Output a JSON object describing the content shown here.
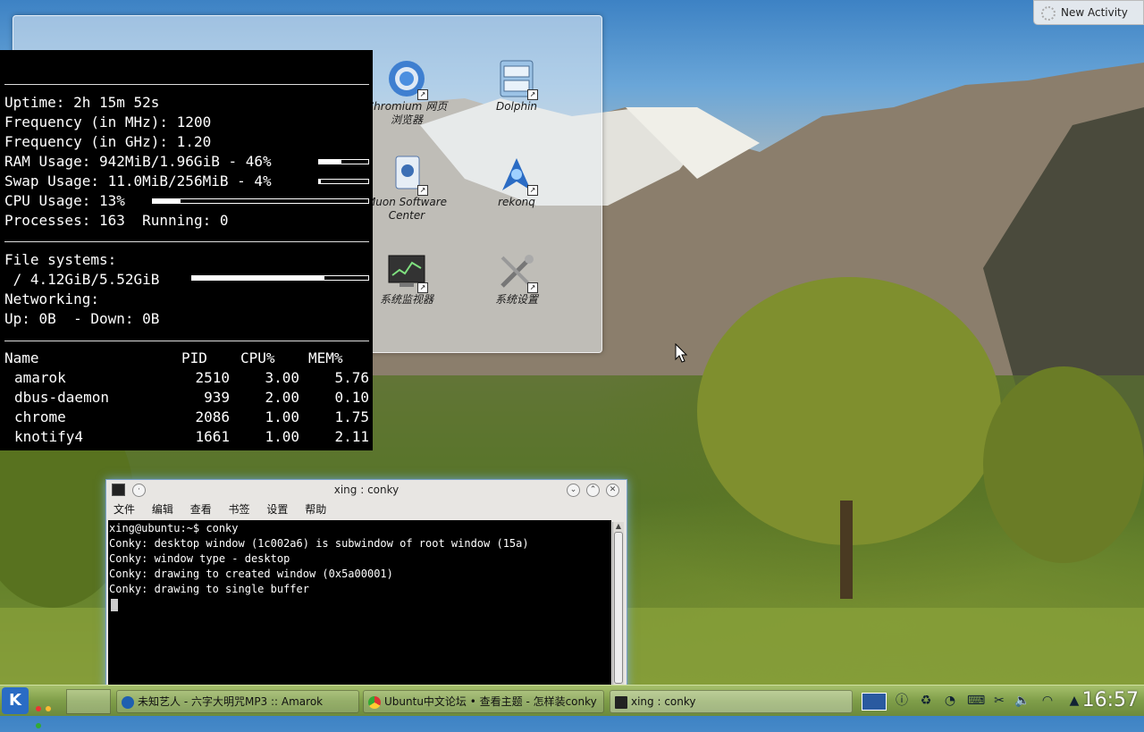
{
  "desktop": {
    "icons": [
      {
        "label1": "Chromium 网页",
        "label2": "浏览器",
        "icon": "chromium-icon"
      },
      {
        "label1": "Dolphin",
        "label2": "",
        "icon": "dolphin-icon"
      },
      {
        "label1": "Muon Software",
        "label2": "Center",
        "icon": "muon-icon"
      },
      {
        "label1": "rekonq",
        "label2": "",
        "icon": "rekonq-icon"
      },
      {
        "label1": "系统监视器",
        "label2": "",
        "icon": "system-monitor-icon"
      },
      {
        "label1": "系统设置",
        "label2": "",
        "icon": "system-settings-icon"
      }
    ],
    "activity_button": "New Activity"
  },
  "conky": {
    "uptime_label": "Uptime:",
    "uptime": "2h 15m 52s",
    "freq_mhz_label": "Frequency (in MHz):",
    "freq_mhz": "1200",
    "freq_ghz_label": "Frequency (in GHz):",
    "freq_ghz": "1.20",
    "ram_label": "RAM Usage:",
    "ram": "942MiB/1.96GiB - 46%",
    "ram_fraction": 0.46,
    "swap_label": "Swap Usage:",
    "swap": "11.0MiB/256MiB - 4%",
    "swap_fraction": 0.04,
    "cpu_label": "CPU Usage:",
    "cpu": "13%",
    "cpu_fraction": 0.13,
    "processes_label": "Processes:",
    "processes": "163",
    "running_label": "Running:",
    "running": "0",
    "fs_label": "File systems:",
    "fs": " / 4.12GiB/5.52GiB",
    "fs_fraction": 0.75,
    "net_label": "Networking:",
    "up_label": "Up:",
    "up": "0B",
    "down_label": "- Down:",
    "down": "0B",
    "proc_headers": [
      "Name",
      "PID",
      "CPU%",
      "MEM%"
    ],
    "procs": [
      {
        "name": "amarok",
        "pid": "2510",
        "cpu": "3.00",
        "mem": "5.76"
      },
      {
        "name": "dbus-daemon",
        "pid": "939",
        "cpu": "2.00",
        "mem": "0.10"
      },
      {
        "name": "chrome",
        "pid": "2086",
        "cpu": "1.00",
        "mem": "1.75"
      },
      {
        "name": "knotify4",
        "pid": "1661",
        "cpu": "1.00",
        "mem": "2.11"
      }
    ]
  },
  "terminal": {
    "title": "xing : conky",
    "menu": [
      "文件",
      "编辑",
      "查看",
      "书签",
      "设置",
      "帮助"
    ],
    "lines": [
      "xing@ubuntu:~$ conky",
      "Conky: desktop window (1c002a6) is subwindow of root window (15a)",
      "Conky: window type - desktop",
      "Conky: drawing to created window (0x5a00001)",
      "Conky: drawing to single buffer"
    ]
  },
  "taskbar": {
    "tasks": [
      {
        "label": "未知艺人 - 六字大明咒MP3 :: Amarok",
        "icon": "amarok-icon"
      },
      {
        "label": "Ubuntu中文论坛 • 查看主题 - 怎样装conky",
        "icon": "chrome-icon"
      },
      {
        "label": "xing : conky",
        "icon": "terminal-icon"
      }
    ],
    "clock": "16:57"
  }
}
